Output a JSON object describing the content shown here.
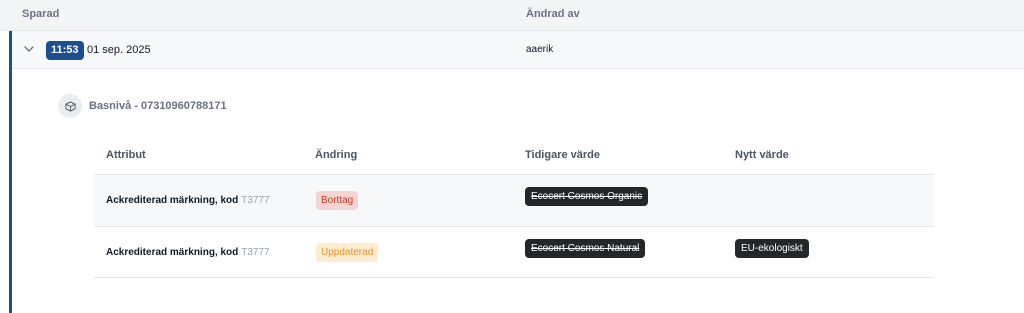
{
  "header": {
    "saved_label": "Sparad",
    "changed_by_label": "Ändrad av"
  },
  "entry": {
    "time": "11:53",
    "date": "01 sep. 2025",
    "user": "aaerik",
    "icon_chevron": "chevron-down-icon",
    "level": {
      "icon": "cube-icon",
      "label": "Basnivå - 07310960788171"
    },
    "table": {
      "columns": [
        "Attribut",
        "Ändring",
        "Tidigare värde",
        "Nytt värde"
      ],
      "rows": [
        {
          "attribute": "Ackrediterad märkning, kod",
          "code": "T3777",
          "change": "Borttag",
          "previous": "Ecocert Cosmos Organic",
          "new": ""
        },
        {
          "attribute": "Ackrediterad märkning, kod",
          "code": "T3777",
          "change": "Uppdaterad",
          "previous": "Ecocert Cosmos Natural",
          "new": "EU-ekologiskt"
        }
      ]
    }
  },
  "colors": {
    "accent": "#1d4f8f",
    "removed_bg": "#f6d4d4",
    "removed_text": "#c0392b",
    "updated_bg": "#fdeccd",
    "updated_text": "#e0922f",
    "value_bg": "#242629"
  }
}
